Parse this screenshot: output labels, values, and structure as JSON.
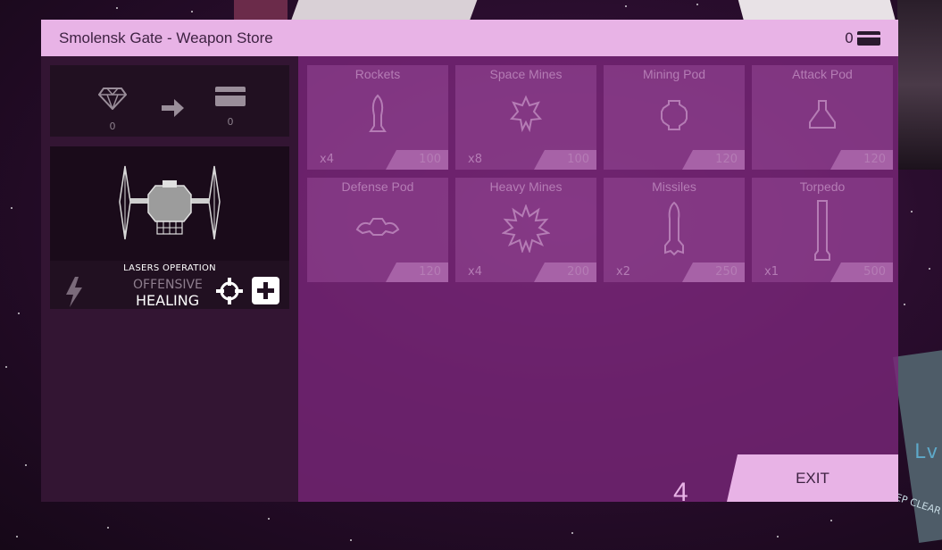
{
  "window": {
    "title": "Smolensk Gate - Weapon Store",
    "credits": "0"
  },
  "exchange": {
    "gems_value": "0",
    "credits_value": "0"
  },
  "ship": {
    "operation_label": "LASERS OPERATION",
    "mode_offensive": "OFFENSIVE",
    "mode_healing": "HEALING"
  },
  "weapons": [
    {
      "name": "Rockets",
      "icon": "rocket-icon",
      "qty": "x4",
      "price": "100"
    },
    {
      "name": "Space Mines",
      "icon": "space-mine-icon",
      "qty": "x8",
      "price": "100"
    },
    {
      "name": "Mining Pod",
      "icon": "mining-pod-icon",
      "qty": "",
      "price": "120"
    },
    {
      "name": "Attack Pod",
      "icon": "attack-pod-icon",
      "qty": "",
      "price": "120"
    },
    {
      "name": "Defense Pod",
      "icon": "defense-pod-icon",
      "qty": "",
      "price": "120"
    },
    {
      "name": "Heavy Mines",
      "icon": "heavy-mine-icon",
      "qty": "x4",
      "price": "200"
    },
    {
      "name": "Missiles",
      "icon": "missile-icon",
      "qty": "x2",
      "price": "250"
    },
    {
      "name": "Torpedo",
      "icon": "torpedo-icon",
      "qty": "x1",
      "price": "500"
    }
  ],
  "footer": {
    "count": "4",
    "exit_label": "EXIT"
  },
  "background": {
    "keep_clear_text": "KEEP CLEAR",
    "lv_text": "Lv"
  },
  "colors": {
    "accent": "#e8b3e6",
    "panel_dark": "#331533",
    "store_panel": "#78267a"
  }
}
